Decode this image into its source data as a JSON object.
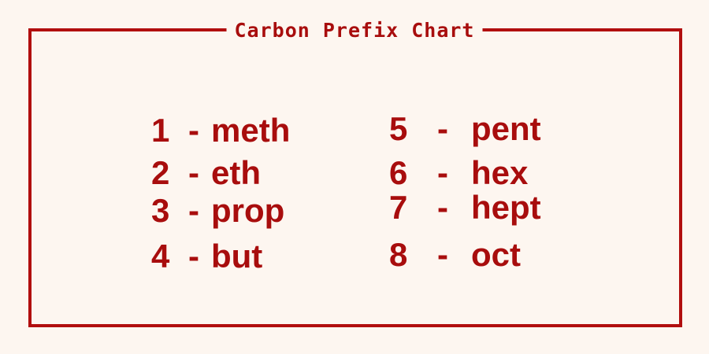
{
  "title": "Carbon Prefix Chart",
  "entries": [
    {
      "number": "1",
      "dash": "-",
      "prefix": "meth"
    },
    {
      "number": "2",
      "dash": "-",
      "prefix": "eth"
    },
    {
      "number": "3",
      "dash": "-",
      "prefix": "prop"
    },
    {
      "number": "4",
      "dash": "-",
      "prefix": "but"
    },
    {
      "number": "5",
      "dash": "-",
      "prefix": "pent"
    },
    {
      "number": "6",
      "dash": "-",
      "prefix": "hex"
    },
    {
      "number": "7",
      "dash": "-",
      "prefix": "hept"
    },
    {
      "number": "8",
      "dash": "-",
      "prefix": "oct"
    }
  ],
  "colors": {
    "ink": "#a80d0d",
    "border": "#b10e0e",
    "background": "#fdf6f0"
  }
}
